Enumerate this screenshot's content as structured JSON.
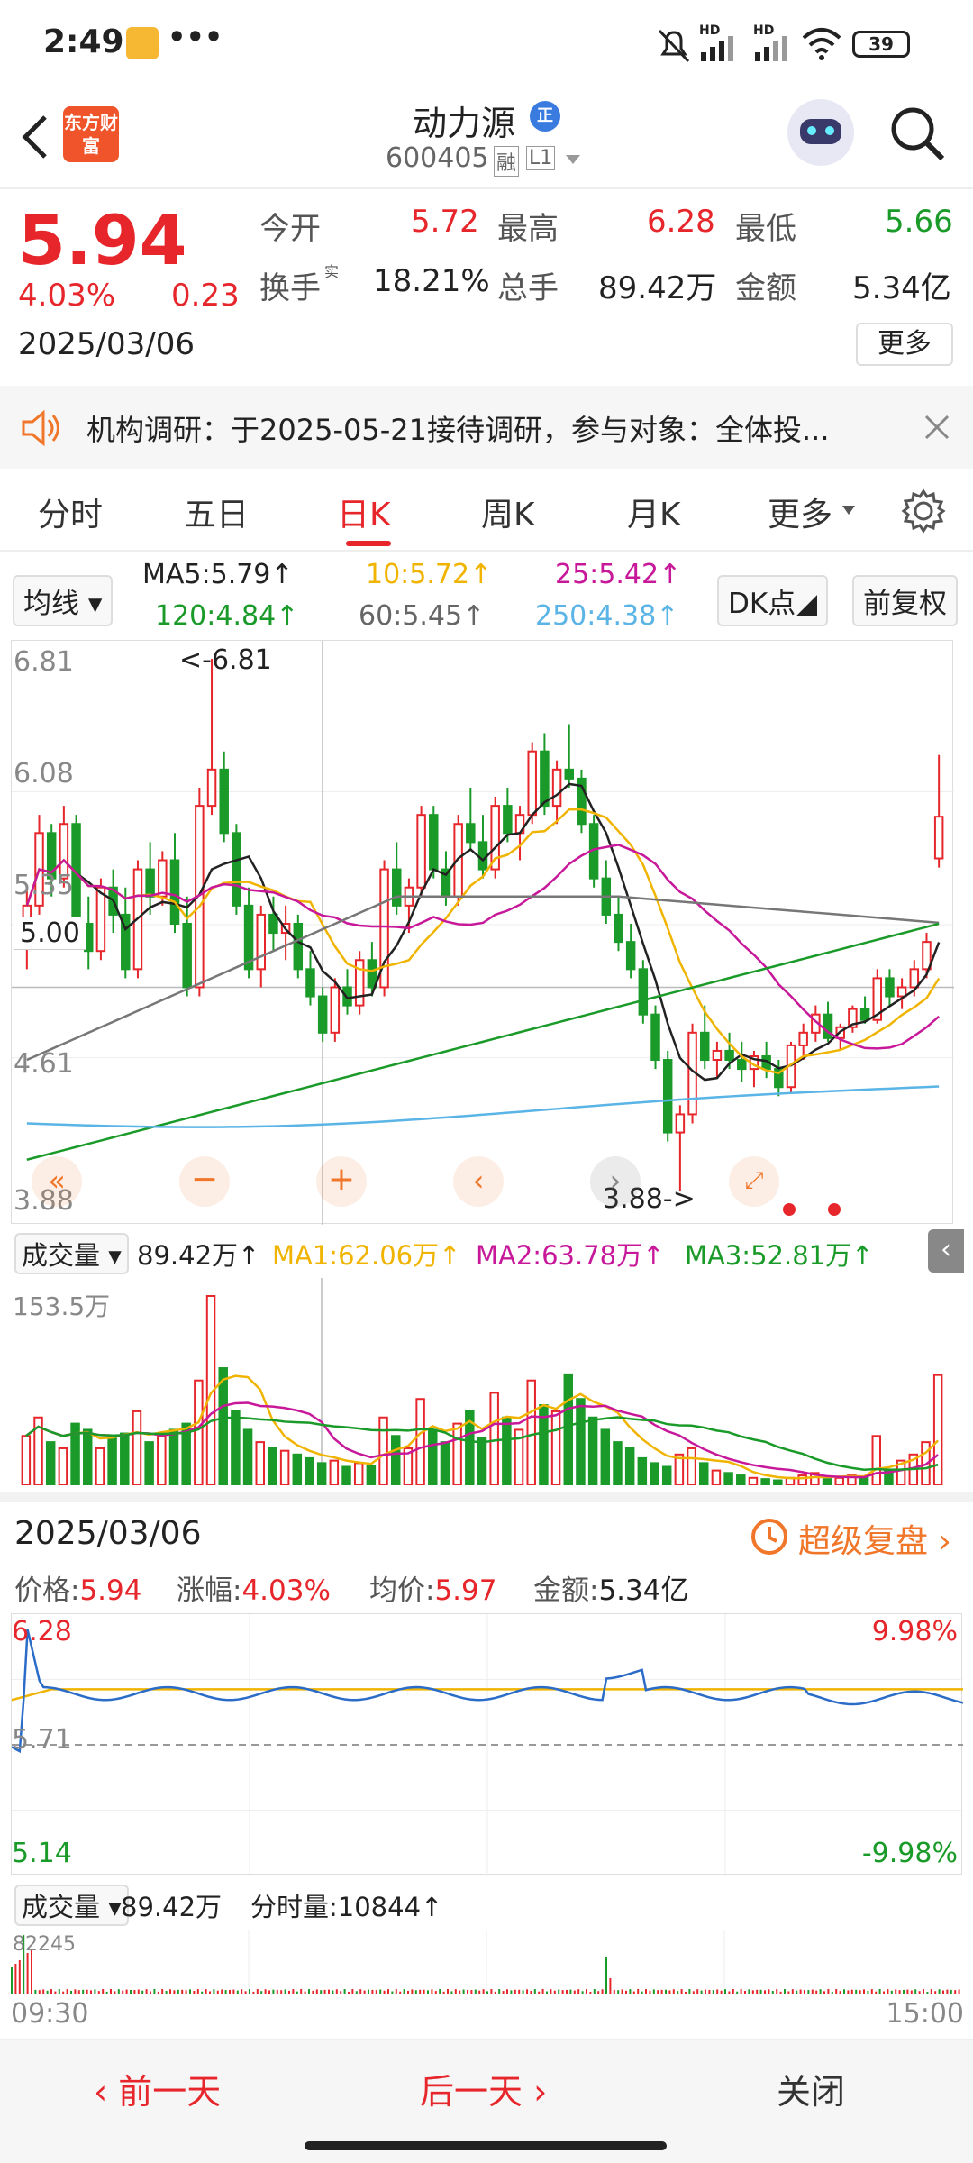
{
  "status": {
    "time": "2:49",
    "dots": "•••",
    "hd1": "HD",
    "hd2": "HD",
    "battery": "39"
  },
  "header": {
    "logo_text": "东方财富",
    "stock_name": "动力源",
    "badge": "正",
    "stock_code": "600405",
    "tag_margin": "融",
    "tag_level": "L1"
  },
  "quote": {
    "price": "5.94",
    "change_pct": "4.03%",
    "change_abs": "0.23",
    "date": "2025/03/06",
    "open_label": "今开",
    "open": "5.72",
    "high_label": "最高",
    "high": "6.28",
    "low_label": "最低",
    "low": "5.66",
    "turnover_label": "换手",
    "turnover_sup": "实",
    "turnover": "18.21%",
    "volume_label": "总手",
    "volume": "89.42万",
    "amount_label": "金额",
    "amount": "5.34亿",
    "more_button": "更多"
  },
  "notice": {
    "text": "机构调研：于2025-05-21接待调研，参与对象：全体投..."
  },
  "tabs": {
    "items": [
      "分时",
      "五日",
      "日K",
      "周K",
      "月K",
      "更多"
    ],
    "active": "日K"
  },
  "ma_row": {
    "selector": "均线",
    "ma5": "MA5:5.79",
    "ma10": "10:5.72",
    "ma25": "25:5.42",
    "ma120": "120:4.84",
    "ma60": "60:5.45",
    "ma250": "250:4.38",
    "dk_button": "DK点",
    "adjust_button": "前复权"
  },
  "kline": {
    "y_labels": [
      "6.81",
      "6.08",
      "5.35",
      "5.00",
      "4.61",
      "3.88"
    ],
    "max_mark": "<-6.81",
    "min_mark": "3.88->",
    "colors": {
      "up": "#e6262b",
      "down": "#1a9a28",
      "ma5": "#222222",
      "ma10": "#f0b400",
      "ma25": "#c8189a",
      "ma60": "#777777",
      "ma120": "#1a9a28",
      "ma250": "#5ab4e6"
    }
  },
  "volume1": {
    "selector": "成交量",
    "value": "89.42万",
    "ma1": "MA1:62.06万",
    "ma2": "MA2:63.78万",
    "ma3": "MA3:52.81万",
    "y_max": "153.5万"
  },
  "detail": {
    "date": "2025/03/06",
    "replay_link": "超级复盘",
    "price_label": "价格:",
    "price": "5.94",
    "chg_label": "涨幅:",
    "chg": "4.03%",
    "avg_label": "均价:",
    "avg": "5.97",
    "amt_label": "金额:",
    "amt": "5.34亿"
  },
  "intraday": {
    "high": "6.28",
    "mid": "5.71",
    "low": "5.14",
    "high_pct": "9.98%",
    "low_pct": "-9.98%"
  },
  "volume2": {
    "selector": "成交量",
    "value": "89.42万",
    "minute_label": "分时量:10844",
    "y_max": "82245",
    "start": "09:30",
    "end": "15:00"
  },
  "bottom": {
    "prev": "前一天",
    "next": "后一天",
    "close": "关闭"
  },
  "chart_data": [
    {
      "type": "candlestick",
      "title": "",
      "ylim": [
        3.88,
        6.81
      ],
      "ohlc": [
        [
          5.3,
          5.55,
          5.1,
          5.45
        ],
        [
          5.45,
          5.95,
          5.4,
          5.85
        ],
        [
          5.85,
          5.9,
          5.5,
          5.6
        ],
        [
          5.6,
          6.0,
          5.55,
          5.9
        ],
        [
          5.9,
          5.95,
          5.3,
          5.35
        ],
        [
          5.35,
          5.5,
          5.1,
          5.2
        ],
        [
          5.2,
          5.6,
          5.15,
          5.55
        ],
        [
          5.55,
          5.65,
          5.3,
          5.4
        ],
        [
          5.4,
          5.55,
          5.05,
          5.1
        ],
        [
          5.1,
          5.7,
          5.05,
          5.65
        ],
        [
          5.65,
          5.8,
          5.4,
          5.5
        ],
        [
          5.5,
          5.75,
          5.45,
          5.7
        ],
        [
          5.7,
          5.85,
          5.3,
          5.35
        ],
        [
          5.35,
          5.5,
          4.95,
          5.0
        ],
        [
          5.0,
          6.1,
          4.95,
          6.0
        ],
        [
          6.0,
          6.81,
          5.95,
          6.2
        ],
        [
          6.2,
          6.3,
          5.8,
          5.85
        ],
        [
          5.85,
          5.9,
          5.4,
          5.45
        ],
        [
          5.45,
          5.55,
          5.05,
          5.1
        ],
        [
          5.1,
          5.45,
          5.0,
          5.4
        ],
        [
          5.4,
          5.5,
          5.2,
          5.3
        ],
        [
          5.3,
          5.45,
          5.15,
          5.35
        ],
        [
          5.35,
          5.4,
          5.05,
          5.1
        ],
        [
          5.1,
          5.2,
          4.9,
          4.95
        ],
        [
          4.95,
          5.0,
          4.7,
          4.75
        ],
        [
          4.75,
          5.05,
          4.7,
          5.0
        ],
        [
          5.0,
          5.1,
          4.85,
          4.9
        ],
        [
          4.9,
          5.2,
          4.85,
          5.15
        ],
        [
          5.15,
          5.25,
          4.95,
          5.0
        ],
        [
          5.0,
          5.7,
          4.95,
          5.65
        ],
        [
          5.65,
          5.8,
          5.4,
          5.45
        ],
        [
          5.45,
          5.6,
          5.3,
          5.55
        ],
        [
          5.55,
          6.0,
          5.5,
          5.95
        ],
        [
          5.95,
          6.0,
          5.6,
          5.65
        ],
        [
          5.65,
          5.75,
          5.45,
          5.5
        ],
        [
          5.5,
          5.95,
          5.45,
          5.9
        ],
        [
          5.9,
          6.1,
          5.75,
          5.8
        ],
        [
          5.8,
          5.95,
          5.6,
          5.65
        ],
        [
          5.65,
          6.05,
          5.6,
          6.0
        ],
        [
          6.0,
          6.1,
          5.8,
          5.85
        ],
        [
          5.85,
          6.0,
          5.7,
          5.95
        ],
        [
          5.95,
          6.35,
          5.9,
          6.3
        ],
        [
          6.3,
          6.4,
          5.95,
          6.0
        ],
        [
          6.0,
          6.25,
          5.9,
          6.2
        ],
        [
          6.2,
          6.45,
          6.1,
          6.15
        ],
        [
          6.15,
          6.2,
          5.85,
          5.9
        ],
        [
          5.9,
          5.95,
          5.55,
          5.6
        ],
        [
          5.6,
          5.7,
          5.35,
          5.4
        ],
        [
          5.4,
          5.5,
          5.2,
          5.25
        ],
        [
          5.25,
          5.35,
          5.05,
          5.1
        ],
        [
          5.1,
          5.15,
          4.8,
          4.85
        ],
        [
          4.85,
          4.9,
          4.55,
          4.6
        ],
        [
          4.6,
          4.65,
          4.15,
          4.2
        ],
        [
          4.2,
          4.35,
          3.88,
          4.3
        ],
        [
          4.3,
          4.8,
          4.25,
          4.75
        ],
        [
          4.75,
          4.9,
          4.55,
          4.6
        ],
        [
          4.6,
          4.7,
          4.5,
          4.65
        ],
        [
          4.65,
          4.75,
          4.55,
          4.6
        ],
        [
          4.6,
          4.7,
          4.48,
          4.55
        ],
        [
          4.55,
          4.65,
          4.45,
          4.62
        ],
        [
          4.62,
          4.7,
          4.5,
          4.55
        ],
        [
          4.55,
          4.6,
          4.4,
          4.45
        ],
        [
          4.45,
          4.7,
          4.42,
          4.68
        ],
        [
          4.68,
          4.8,
          4.6,
          4.75
        ],
        [
          4.75,
          4.9,
          4.7,
          4.85
        ],
        [
          4.85,
          4.92,
          4.7,
          4.72
        ],
        [
          4.72,
          4.8,
          4.65,
          4.78
        ],
        [
          4.78,
          4.9,
          4.75,
          4.88
        ],
        [
          4.88,
          4.95,
          4.8,
          4.82
        ],
        [
          4.82,
          5.1,
          4.8,
          5.05
        ],
        [
          5.05,
          5.1,
          4.9,
          4.95
        ],
        [
          4.95,
          5.05,
          4.88,
          5.0
        ],
        [
          5.0,
          5.15,
          4.95,
          5.1
        ],
        [
          5.1,
          5.3,
          5.05,
          5.25
        ],
        [
          5.71,
          6.28,
          5.66,
          5.94
        ]
      ]
    },
    {
      "type": "bar",
      "title": "成交量",
      "ylim": [
        0,
        153.5
      ],
      "values": [
        40,
        55,
        35,
        30,
        50,
        45,
        30,
        38,
        42,
        60,
        35,
        40,
        45,
        50,
        85,
        153.5,
        95,
        60,
        45,
        35,
        30,
        28,
        25,
        22,
        18,
        20,
        15,
        18,
        16,
        55,
        40,
        30,
        70,
        45,
        35,
        50,
        60,
        38,
        75,
        55,
        45,
        85,
        65,
        60,
        90,
        70,
        55,
        45,
        35,
        30,
        22,
        18,
        15,
        25,
        30,
        18,
        12,
        10,
        8,
        6,
        5,
        4,
        6,
        8,
        10,
        5,
        6,
        8,
        7,
        40,
        12,
        20,
        25,
        35,
        89.42
      ]
    },
    {
      "type": "line",
      "title": "分时",
      "ylim": [
        5.14,
        6.28
      ]
    }
  ]
}
